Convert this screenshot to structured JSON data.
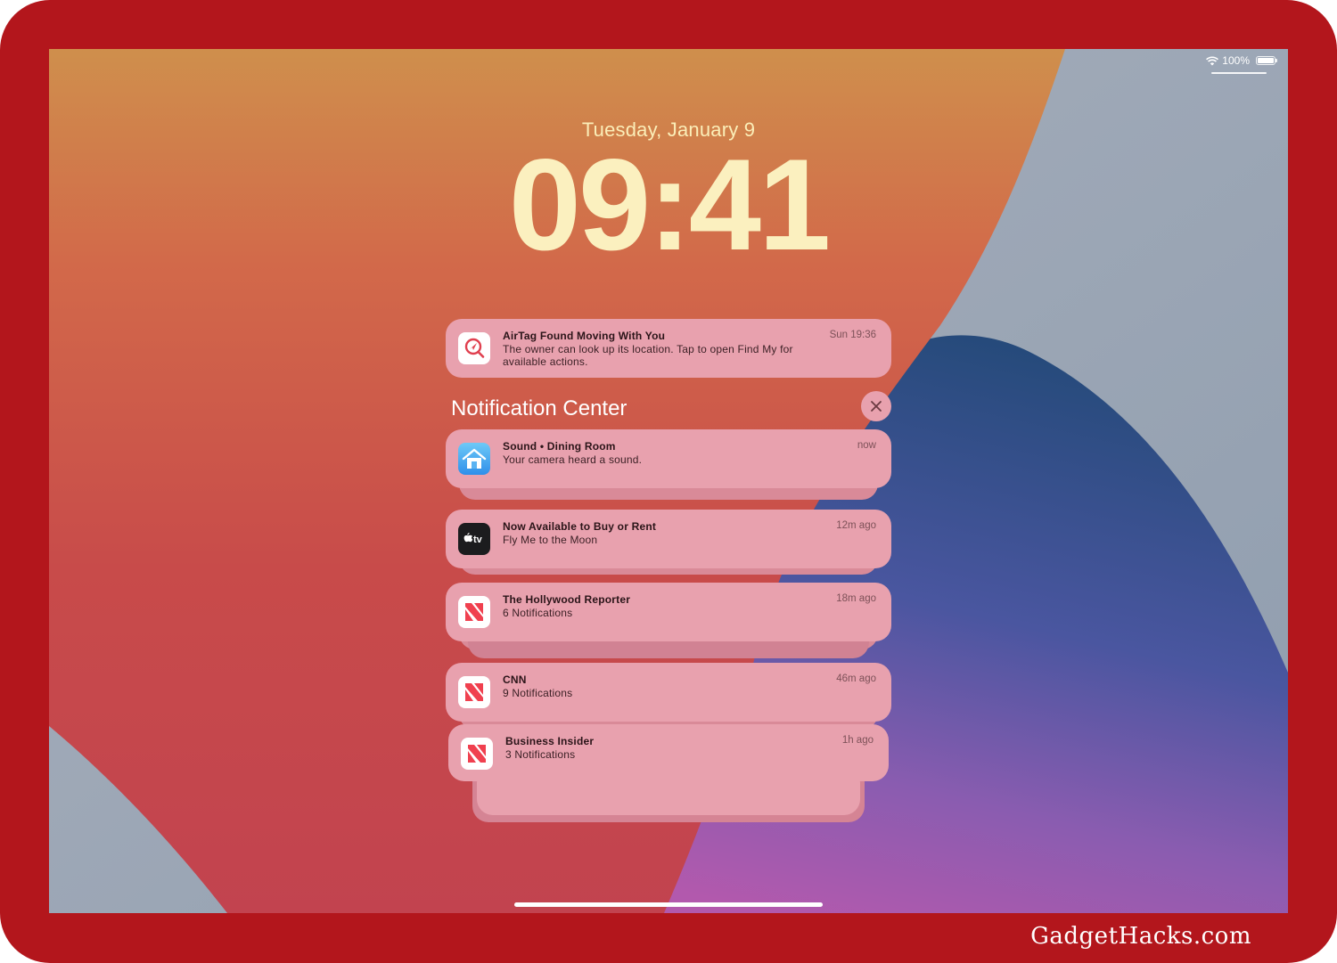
{
  "status_bar": {
    "battery_text": "100%",
    "icons": [
      "wifi-icon",
      "battery-icon"
    ]
  },
  "lockscreen": {
    "date": "Tuesday, January 9",
    "time": "09:41"
  },
  "pinned_notification": {
    "title": "AirTag Found Moving With You",
    "body": "The owner can look up its location. Tap to open Find My for available actions.",
    "time": "Sun 19:36",
    "icon": "find-my-icon"
  },
  "notification_center": {
    "title": "Notification Center",
    "close_icon": "close-icon",
    "items": [
      {
        "title": "Sound • Dining Room",
        "body": "Your camera heard a sound.",
        "time": "now",
        "icon": "home-app-icon"
      },
      {
        "title": "Now Available to Buy or Rent",
        "body": "Fly Me to the Moon",
        "time": "12m ago",
        "icon": "apple-tv-icon"
      },
      {
        "title": "The Hollywood Reporter",
        "body": "6 Notifications",
        "time": "18m ago",
        "icon": "news-icon"
      },
      {
        "title": "CNN",
        "body": "9 Notifications",
        "time": "46m ago",
        "icon": "news-icon"
      },
      {
        "title": "Business Insider",
        "body": "3 Notifications",
        "time": "1h ago",
        "icon": "news-icon"
      }
    ]
  },
  "watermark": "GadgetHacks.com",
  "colors": {
    "frame": "#b3161c",
    "card": "#e8a1ae",
    "clock": "#fbf0bf"
  }
}
